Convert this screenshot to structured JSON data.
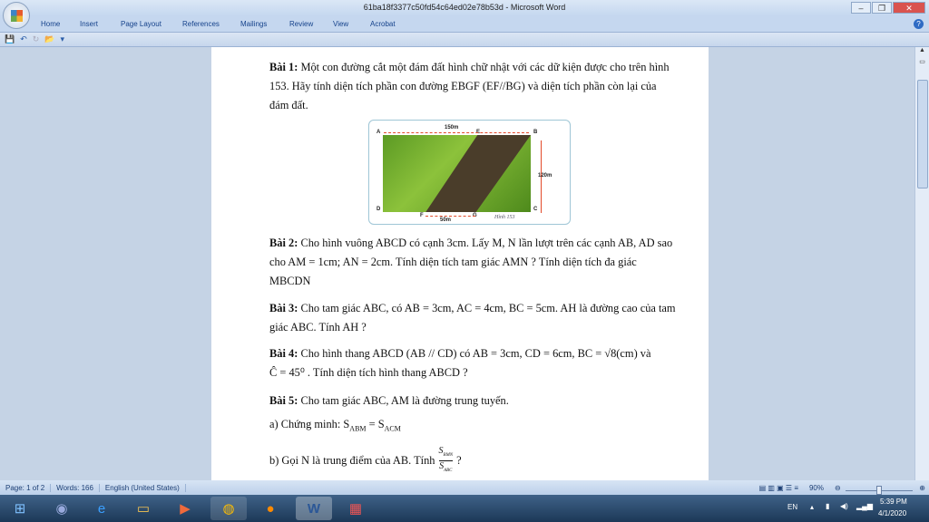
{
  "window": {
    "title": "61ba18f3377c50fd54c64ed02e78b53d - Microsoft Word"
  },
  "ribbon_tabs": [
    "Home",
    "Insert",
    "Page Layout",
    "References",
    "Mailings",
    "Review",
    "View",
    "Acrobat"
  ],
  "document": {
    "bai1_label": "Bài 1:",
    "bai1_text": "Một con đường cắt một đám đất hình chữ nhật với các dữ kiện được cho trên hình 153. Hãy tính diện tích phần con đường EBGF (EF//BG) và diện tích phần còn lại của đám đất.",
    "figure": {
      "A": "A",
      "B": "B",
      "C": "C",
      "D": "D",
      "E": "E",
      "F": "F",
      "G": "G",
      "top": "150m",
      "right": "120m",
      "bottom": "50m",
      "caption": "Hình 153"
    },
    "bai2_label": "Bài 2:",
    "bai2_text": "Cho hình vuông ABCD có cạnh 3cm. Lấy M, N lần lượt trên các cạnh AB, AD sao cho AM = 1cm; AN = 2cm. Tính diện tích tam giác AMN ? Tính diện tích đa giác MBCDN",
    "bai3_label": "Bài 3:",
    "bai3_text": "Cho tam giác ABC, có AB = 3cm, AC = 4cm, BC = 5cm. AH là đường cao của tam giác ABC. Tính AH ?",
    "bai4_label": "Bài 4:",
    "bai4_text": "Cho hình thang ABCD (AB // CD) có AB = 3cm, CD = 6cm, BC = √8(cm) và",
    "bai4_text2": "Ĉ = 45⁰ . Tính diện tích hình thang ABCD ?",
    "bai5_label": "Bài 5:",
    "bai5_text": "Cho tam giác ABC,  AM là đường trung tuyến.",
    "bai5a": "a) Chứng minh: S",
    "bai5a_sub1": "ABM",
    "bai5a_eq": " = S",
    "bai5a_sub2": "ACM",
    "bai5b": "b) Gọi N là trung điểm của AB. Tính",
    "bai5b_num": "S",
    "bai5b_num_sub": "BMN",
    "bai5b_den": "S",
    "bai5b_den_sub": "ABC",
    "bai5b_q": "?"
  },
  "status": {
    "page": "Page: 1 of 2",
    "words": "Words: 166",
    "language": "English (United States)",
    "zoom": "90%"
  },
  "tray": {
    "lang": "EN",
    "time": "5:39 PM",
    "date": "4/1/2020"
  }
}
